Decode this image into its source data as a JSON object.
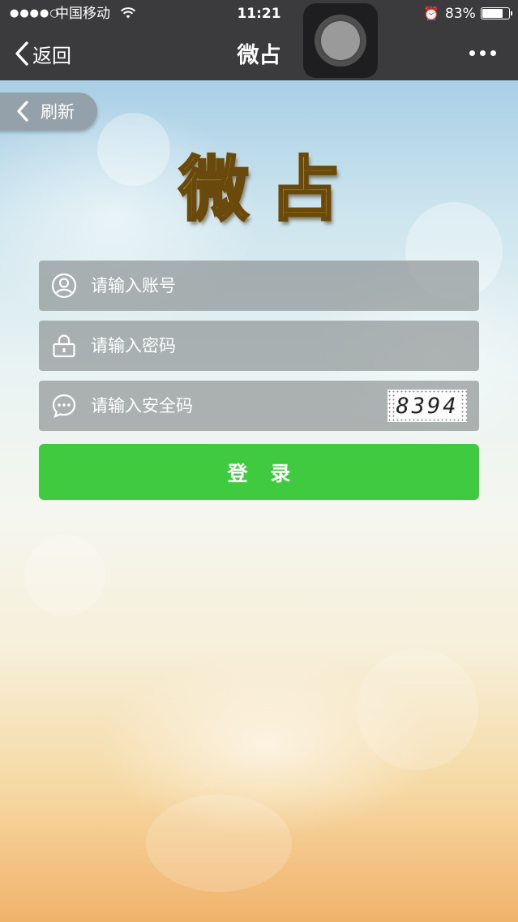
{
  "status_bar": {
    "signal": "●●●●○",
    "carrier": "中国移动",
    "time": "11:21",
    "battery": "83%",
    "battery_level": 0.83
  },
  "nav": {
    "back_label": "返回",
    "title": "微占"
  },
  "refresh_label": "刷新",
  "logo": {
    "char1": "微",
    "char2": "占"
  },
  "form": {
    "account_placeholder": "请输入账号",
    "password_placeholder": "请输入密码",
    "captcha_placeholder": "请输入安全码",
    "captcha_code": "8394",
    "login_label": "登录"
  },
  "colors": {
    "nav_bg": "#3b3b3e",
    "login_button": "#3fca3f",
    "field_bg": "#8a8f8f"
  }
}
